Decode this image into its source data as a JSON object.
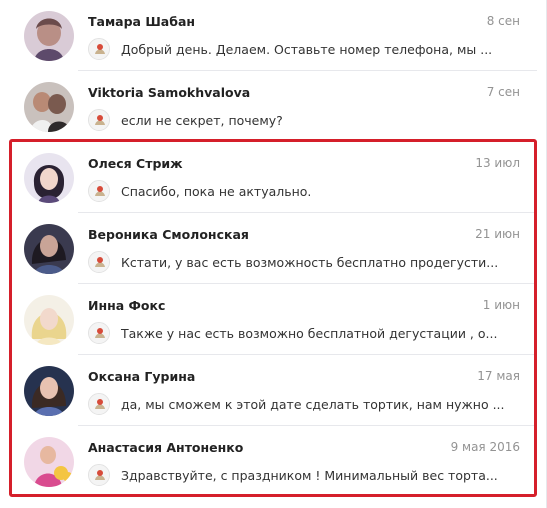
{
  "dialogs": [
    {
      "name": "Тамара Шабан",
      "date": "8 сен",
      "snippet": "Добрый день. Делаем. Оставьте номер телефона, мы ...",
      "avatar_color": "#b7a6b8"
    },
    {
      "name": "Viktoria Samokhvalova",
      "date": "7 сен",
      "snippet": "если не секрет, почему?",
      "avatar_color": "#7b5b53"
    },
    {
      "name": "Олеся Стриж",
      "date": "13 июл",
      "snippet": "Спасибо, пока не актуально.",
      "avatar_color": "#3b2f4b"
    },
    {
      "name": "Вероника Смолонская",
      "date": "21 июн",
      "snippet": "Кстати, у вас есть возможность бесплатно продегусти...",
      "avatar_color": "#3c3d58"
    },
    {
      "name": "Инна Фокс",
      "date": "1 июн",
      "snippet": "Также у нас есть возможно бесплатной дегустации , о...",
      "avatar_color": "#e6d6a8"
    },
    {
      "name": "Оксана Гурина",
      "date": "17 мая",
      "snippet": "да, мы сможем к этой дате сделать тортик, нам нужно ...",
      "avatar_color": "#2c3b5e"
    },
    {
      "name": "Анастасия Антоненко",
      "date": "9 мая 2016",
      "snippet": "Здравствуйте, с праздником ! Минимальный вес торта...",
      "avatar_color": "#d65d93"
    }
  ],
  "highlight_color": "#d51f2a"
}
